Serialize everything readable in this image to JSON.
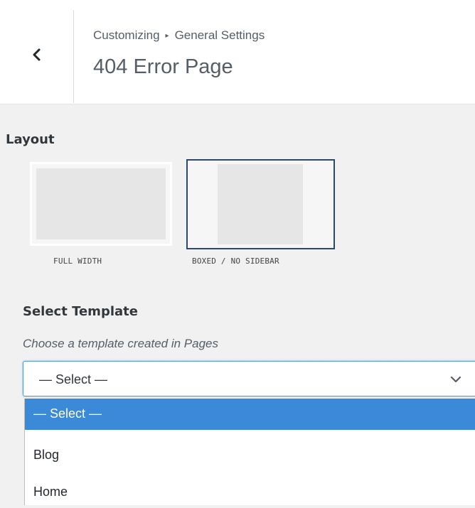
{
  "header": {
    "back_icon": "chevron-left-icon",
    "breadcrumb": [
      "Customizing",
      "General Settings"
    ],
    "breadcrumb_separator": "▸",
    "title": "404 Error Page"
  },
  "layout": {
    "label": "Layout",
    "options": [
      {
        "label": "FULL WIDTH",
        "selected": false
      },
      {
        "label": "BOXED / NO SIDEBAR",
        "selected": true
      }
    ]
  },
  "template": {
    "label": "Select Template",
    "description": "Choose a template created in Pages",
    "selected_value": "— Select —",
    "caret_icon": "chevron-down-icon",
    "options": [
      "— Select —",
      "Blog",
      "Home"
    ]
  },
  "colors": {
    "accent": "#3b8ad8",
    "selected_border": "#2b4a6b",
    "focus_border": "#5b9dd9"
  }
}
